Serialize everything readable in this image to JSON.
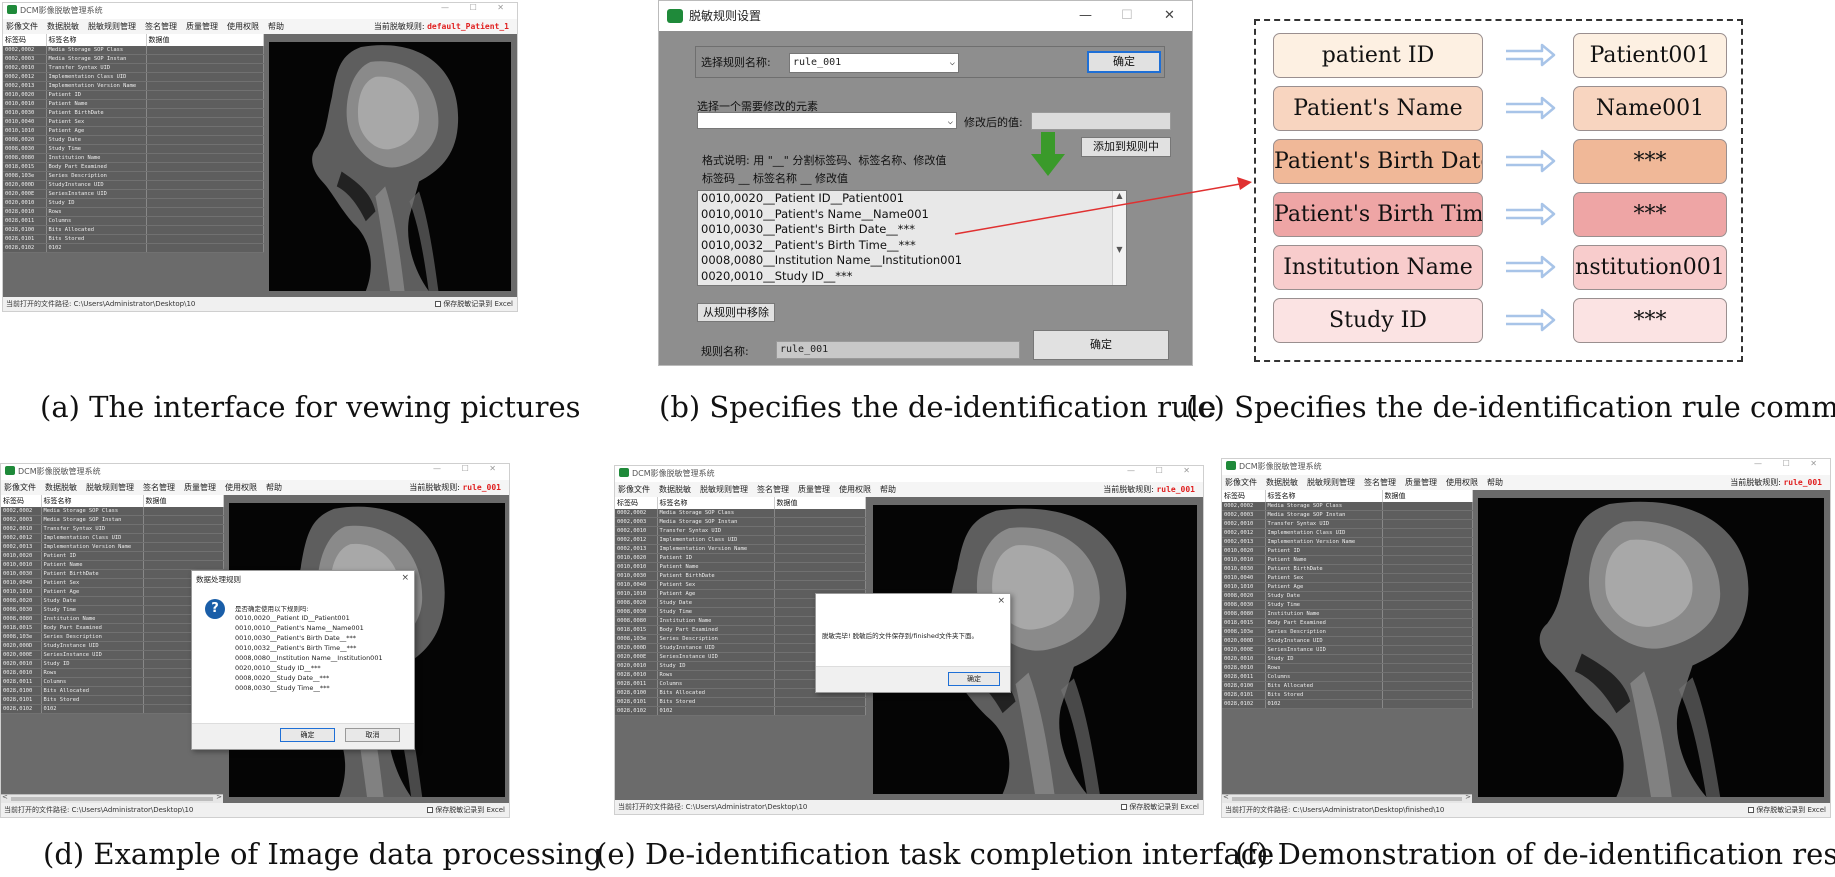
{
  "app": {
    "title": "DCM影像脱敏管理系统",
    "window_controls": "—  ☐  ✕",
    "menu": [
      "影像文件",
      "数据脱敏",
      "脱敏规则管理",
      "签名管理",
      "质量管理",
      "使用权限",
      "帮助"
    ],
    "current_rule_label": "当前脱敏规则:",
    "columns": [
      "标签码",
      "标签名称",
      "数据值"
    ],
    "rows": [
      [
        "0002,0002",
        "Media  Storage SOP Class"
      ],
      [
        "0002,0003",
        "Media  Storage SOP Instan"
      ],
      [
        "0002,0010",
        "Transfer  Syntax UID"
      ],
      [
        "0002,0012",
        "Implementation Class UID"
      ],
      [
        "0002,0013",
        "Implementation Version Name"
      ],
      [
        "0010,0020",
        "Patient ID"
      ],
      [
        "0010,0010",
        "Patient Name"
      ],
      [
        "0010,0030",
        "Patient BirthDate"
      ],
      [
        "0010,0040",
        "Patient Sex"
      ],
      [
        "0010,1010",
        "Patient Age"
      ],
      [
        "0008,0020",
        "Study Date"
      ],
      [
        "0008,0030",
        "Study Time"
      ],
      [
        "0008,0080",
        "Institution Name"
      ],
      [
        "0018,0015",
        "Body Part Examined"
      ],
      [
        "0008,103e",
        "Series Description"
      ],
      [
        "0020,000D",
        "StudyInstance UID"
      ],
      [
        "0020,000E",
        "SeriesInstance UID"
      ],
      [
        "0020,0010",
        "Study ID"
      ],
      [
        "0028,0010",
        "Rows"
      ],
      [
        "0028,0011",
        "Columns"
      ],
      [
        "0028,0100",
        "Bits Allocated"
      ],
      [
        "0028,0101",
        "Bits Stored"
      ],
      [
        "0028,0102",
        "0102"
      ]
    ],
    "status_label": "当前打开的文件路径:",
    "save_record": "保存脱敏记录到 Excel"
  },
  "panel_a": {
    "rule": "default_Patient_1",
    "path": "C:\\Users\\Administrator\\Desktop\\10",
    "caption": "(a) The interface for vewing pictures"
  },
  "panel_d": {
    "rule": "rule_001",
    "path": "C:\\Users\\Administrator\\Desktop\\10",
    "caption": "(d) Example of Image data processing",
    "dialog": {
      "title": "数据处理规则",
      "prompt": "是否确定使用以下规则吗:",
      "lines": [
        "0010,0020__Patient  ID__Patient001",
        "0010,0010__Patient's  Name__Name001",
        "0010,0030__Patient's Birth Date__***",
        "0010,0032__Patient's Birth Time__***",
        "0008,0080__Institution  Name__Institution001",
        "0020,0010__Study  ID__***",
        "0008,0020__Study Date__***",
        "0008,0030__Study Time__***"
      ],
      "ok": "确定",
      "cancel": "取消"
    }
  },
  "panel_e": {
    "rule": "rule_001",
    "path": "C:\\Users\\Administrator\\Desktop\\10",
    "caption": "(e) De-identification task completion interface",
    "dialog": {
      "message": "脱敏完毕! 脱敏后的文件保存到/finished文件夹下面。",
      "ok": "确定"
    }
  },
  "panel_f": {
    "rule": "rule_001",
    "path": "C:\\Users\\Administrator\\Desktop\\finished\\10",
    "caption": "(f) Demonstration of de-identification results"
  },
  "panel_b": {
    "title": "脱敏规则设置",
    "window_controls": [
      "—",
      "☐",
      "✕"
    ],
    "select_rule_label": "选择规则名称:",
    "select_rule_value": "rule_001",
    "confirm_top": "确定",
    "element_label": "选择一个需要修改的元素",
    "new_value_label": "修改后的值:",
    "add_button": "添加到规则中",
    "format_note": "格式说明: 用 \"__\" 分割标签码、标签名称、修改值",
    "format_header": "标签码     __  标签名称      __  修改值",
    "rules": [
      "0010,0020__Patient  ID__Patient001",
      "0010,0010__Patient's  Name__Name001",
      "0010,0030__Patient's  Birth Date__***",
      "0010,0032__Patient's  Birth Time__***",
      "0008,0080__Institution  Name__Institution001",
      "0020,0010__Study  ID__***"
    ],
    "remove_button": "从规则中移除",
    "rule_name_label": "规则名称:",
    "rule_name_value": "rule_001",
    "confirm_bottom": "确定",
    "caption": "(b) Specifies the de-identification rule"
  },
  "panel_c": {
    "caption": "(c) Specifies the de-identification rule comment",
    "rows": [
      {
        "field": "patient ID",
        "value": "Patient001",
        "bg": "#fdf0e2"
      },
      {
        "field": "Patient's Name",
        "value": "Name001",
        "bg": "#f8d5c0"
      },
      {
        "field": "Patient's Birth Date",
        "value": "***",
        "bg": "#f0b898"
      },
      {
        "field": "Patient's Birth Time",
        "value": "***",
        "bg": "#eea5a5"
      },
      {
        "field": "Institution Name",
        "value": "nstitution001",
        "bg": "#f8cccc"
      },
      {
        "field": "Study ID",
        "value": "***",
        "bg": "#fbe3e3"
      }
    ]
  },
  "colors": {
    "rule_red": "#e02020",
    "arrow_blue": "#a8c4e8",
    "pointer_red": "#e03030",
    "down_arrow_green": "#3a9a2a"
  }
}
